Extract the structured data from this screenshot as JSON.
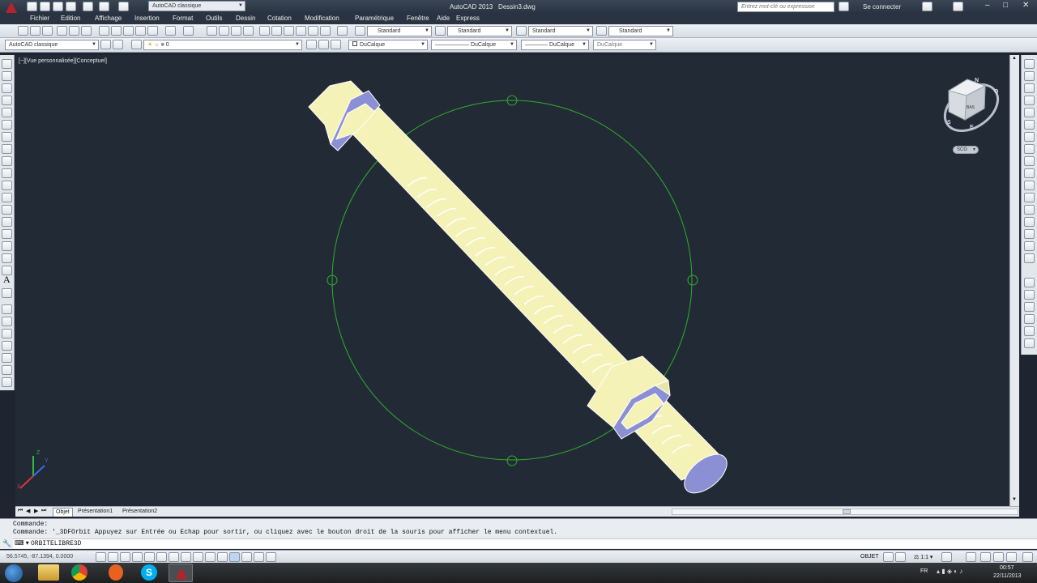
{
  "title": {
    "workspace": "AutoCAD classique",
    "app": "AutoCAD 2013",
    "file": "Dessin3.dwg",
    "search_placeholder": "Entrez mot-clé ou expression",
    "sign_in": "Se connecter"
  },
  "menu": [
    "Fichier",
    "Edition",
    "Affichage",
    "Insertion",
    "Format",
    "Outils",
    "Dessin",
    "Cotation",
    "Modification",
    "Paramétrique",
    "Fenêtre",
    "Aide",
    "Express"
  ],
  "styles": {
    "text_style": "Standard",
    "dim_style": "Standard",
    "table_style": "Standard",
    "multileader_style": "Standard"
  },
  "layers": {
    "workspace": "AutoCAD classique",
    "current_layer": "0",
    "color": "DuCalque",
    "linetype": "DuCalque",
    "lineweight": "DuCalque",
    "plotstyle": "DuCalque"
  },
  "viewport": {
    "label": "[−][Vue personnalisée][Conceptuel]",
    "viewcube_face": "BAS",
    "ucs": "SCG",
    "compass": [
      "N",
      "O",
      "S",
      "E"
    ],
    "axis_labels": [
      "Z",
      "Y",
      "X"
    ]
  },
  "tabs": [
    "Objet",
    "Présentation1",
    "Présentation2"
  ],
  "command": {
    "line1": "Commande:",
    "line2": "Commande: '_3DFOrbit Appuyez sur Entrée ou Echap pour sortir, ou cliquez avec le bouton droit de la souris pour afficher le menu contextuel.",
    "prompt": "ORBITELIBRE3D"
  },
  "status": {
    "coords": "56.5745, -87.1394, 0.0000",
    "space": "OBJET",
    "scale": "1:1"
  },
  "taskbar": {
    "lang": "FR",
    "time": "00:57",
    "date": "22/11/2013"
  },
  "colors": {
    "viewport_bg": "#222a35",
    "bolt_body": "#f5f2b8",
    "bolt_face": "#8b8fd4",
    "orbit_circle": "#2fae2f"
  }
}
